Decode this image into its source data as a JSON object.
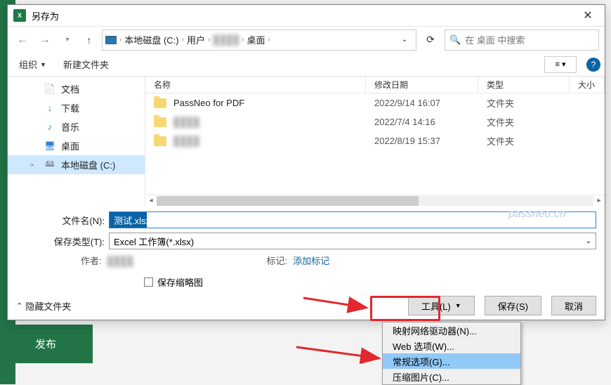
{
  "titlebar": {
    "title": "另存为"
  },
  "breadcrumb": {
    "drive": "本地磁盘 (C:)",
    "seg1": "用户",
    "seg2": "桌面"
  },
  "search": {
    "placeholder": "在 桌面 中搜索"
  },
  "toolbar": {
    "organize": "组织",
    "newfolder": "新建文件夹"
  },
  "sidebar": {
    "items": [
      {
        "label": "文档",
        "icon": "📄",
        "color": "#2e7bd6"
      },
      {
        "label": "下载",
        "icon": "↓",
        "color": "#2e7bd6"
      },
      {
        "label": "音乐",
        "icon": "♪",
        "color": "#2e7bd6"
      },
      {
        "label": "桌面",
        "icon": "🖥",
        "color": "#2e7bd6"
      },
      {
        "label": "本地磁盘 (C:)",
        "icon": "🖴",
        "color": "#888",
        "selected": true,
        "caret": ">"
      }
    ]
  },
  "columns": {
    "name": "名称",
    "date": "修改日期",
    "type": "类型",
    "size": "大小"
  },
  "files": [
    {
      "name": "PassNeo for PDF",
      "date": "2022/9/14 16:07",
      "type": "文件夹"
    },
    {
      "name": "hidden1",
      "date": "2022/7/4 14:16",
      "type": "文件夹",
      "blur": true
    },
    {
      "name": "hidden2",
      "date": "2022/8/19 15:37",
      "type": "文件夹",
      "blur": true
    }
  ],
  "form": {
    "filename_label": "文件名(N):",
    "filename_value": "测试.xlsx",
    "filetype_label": "保存类型(T):",
    "filetype_value": "Excel 工作簿(*.xlsx)",
    "author_label": "作者:",
    "tags_label": "标记:",
    "tags_link": "添加标记",
    "thumbnail": "保存缩略图"
  },
  "footer": {
    "hide": "隐藏文件夹",
    "tools": "工具(L)",
    "save": "保存(S)",
    "cancel": "取消"
  },
  "menu": {
    "items": [
      "映射网络驱动器(N)...",
      "Web 选项(W)...",
      "常规选项(G)...",
      "压缩图片(C)..."
    ],
    "highlighted": 2
  },
  "bg": {
    "publish": "发布"
  },
  "watermark": "passneo.cn"
}
